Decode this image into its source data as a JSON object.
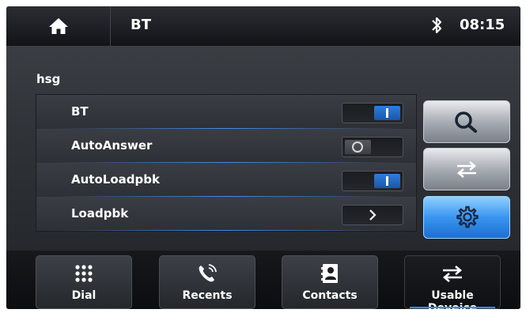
{
  "header": {
    "title": "BT",
    "time": "08:15"
  },
  "device_name": "hsg",
  "settings": [
    {
      "label": "BT",
      "control": "toggle",
      "state": "on"
    },
    {
      "label": "AutoAnswer",
      "control": "toggle",
      "state": "off"
    },
    {
      "label": "AutoLoadpbk",
      "control": "toggle",
      "state": "on"
    },
    {
      "label": "Loadpbk",
      "control": "arrow"
    }
  ],
  "side_buttons": [
    {
      "icon": "search-icon"
    },
    {
      "icon": "swap-arrows-icon"
    },
    {
      "icon": "gear-icon",
      "active": true
    }
  ],
  "tabs": [
    {
      "label": "Dial",
      "icon": "dialpad-icon"
    },
    {
      "label": "Recents",
      "icon": "phone-icon"
    },
    {
      "label": "Contacts",
      "icon": "contacts-icon"
    },
    {
      "label": "Usable Deveice",
      "icon": "swap-arrows-icon",
      "active": true
    }
  ],
  "colors": {
    "accent": "#2f8cf0",
    "background": "#050608"
  }
}
